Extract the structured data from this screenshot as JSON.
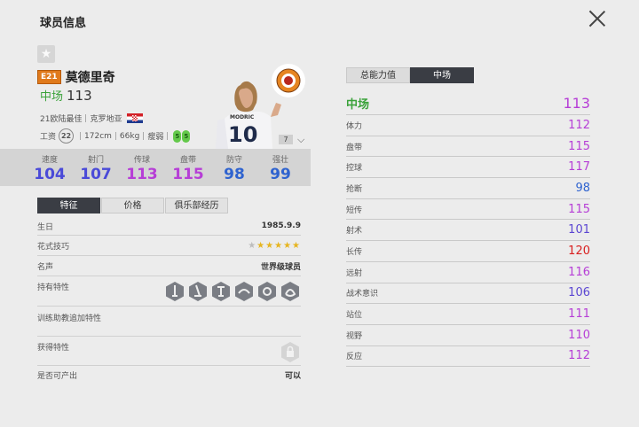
{
  "header": {
    "title": "球员信息"
  },
  "player": {
    "season": "E21",
    "name": "莫德里奇",
    "position": "中场",
    "ovr": "113",
    "award": "21欧陆最佳",
    "nation": "克罗地亚",
    "wage_label": "工资",
    "wage": "22",
    "height": "172cm",
    "weight": "66kg",
    "body": "瘦弱",
    "left_foot": "5",
    "right_foot": "5",
    "enhance_level": "7",
    "shirt_name": "MODRIC",
    "shirt_number": "10"
  },
  "stat_bar": [
    {
      "label": "速度",
      "value": "104",
      "color": "#4a4ad8"
    },
    {
      "label": "射门",
      "value": "107",
      "color": "#4a4ad8"
    },
    {
      "label": "传球",
      "value": "113",
      "color": "#b63ed6"
    },
    {
      "label": "盘带",
      "value": "115",
      "color": "#b63ed6"
    },
    {
      "label": "防守",
      "value": "98",
      "color": "#2f63cf"
    },
    {
      "label": "强壮",
      "value": "99",
      "color": "#2f63cf"
    }
  ],
  "left_tabs": [
    "特征",
    "价格",
    "俱乐部经历"
  ],
  "info": {
    "birthday_label": "生日",
    "birthday": "1985.9.9",
    "skills_label": "花式技巧",
    "skill_stars": 5,
    "fame_label": "名声",
    "fame": "世界级球员",
    "traits_label": "持有特性",
    "training_label": "训练助教追加特性",
    "acquired_label": "获得特性",
    "producible_label": "是否可产出",
    "producible": "可以"
  },
  "right_tabs": [
    "总能力值",
    "中场"
  ],
  "attributes": {
    "head": {
      "label": "中场",
      "value": "113",
      "color": "#b63ed6"
    },
    "items": [
      {
        "label": "体力",
        "value": "112",
        "color": "#b63ed6"
      },
      {
        "label": "盘带",
        "value": "115",
        "color": "#b63ed6"
      },
      {
        "label": "控球",
        "value": "117",
        "color": "#b63ed6"
      },
      {
        "label": "抢断",
        "value": "98",
        "color": "#2f63cf"
      },
      {
        "label": "短传",
        "value": "115",
        "color": "#b63ed6"
      },
      {
        "label": "射术",
        "value": "101",
        "color": "#5b46d2"
      },
      {
        "label": "长传",
        "value": "120",
        "color": "#d81e1e"
      },
      {
        "label": "远射",
        "value": "116",
        "color": "#b63ed6"
      },
      {
        "label": "战术意识",
        "value": "106",
        "color": "#5b46d2"
      },
      {
        "label": "站位",
        "value": "111",
        "color": "#b63ed6"
      },
      {
        "label": "视野",
        "value": "110",
        "color": "#b63ed6"
      },
      {
        "label": "反应",
        "value": "112",
        "color": "#b63ed6"
      }
    ]
  },
  "colors": {
    "accent_green": "#3aa23a",
    "active_tab": "#3a3d44"
  }
}
